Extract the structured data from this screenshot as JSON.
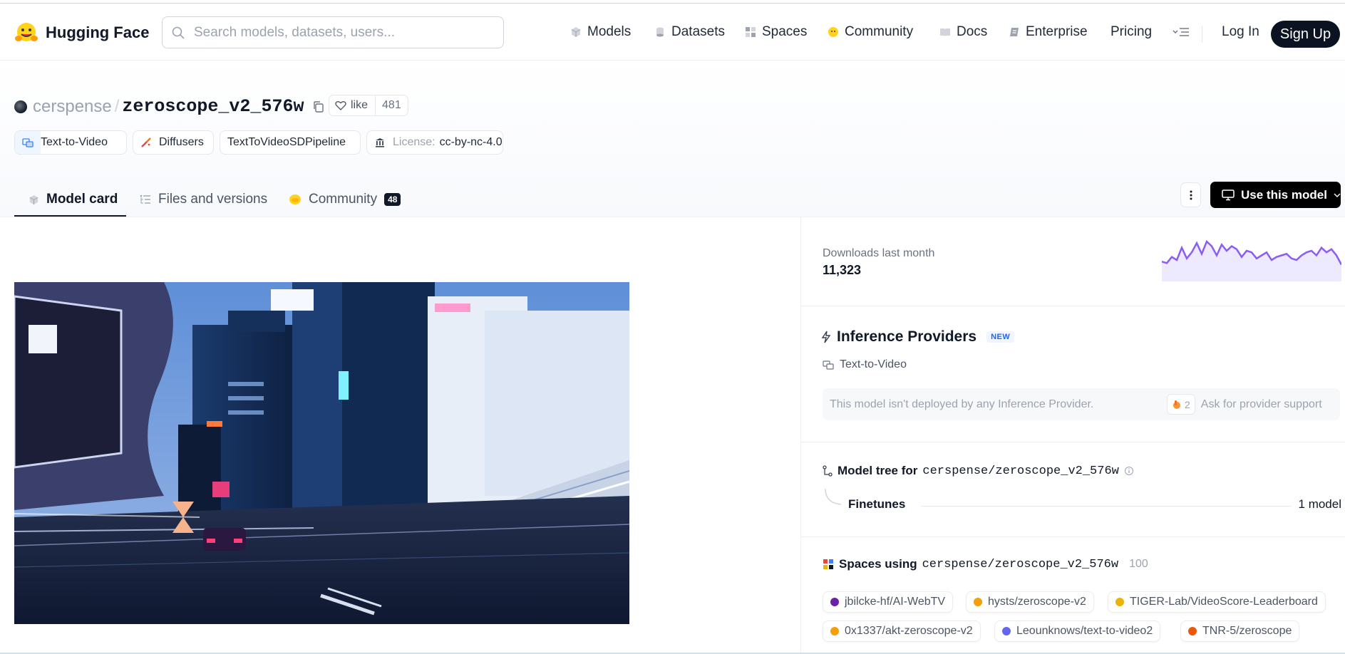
{
  "header": {
    "brand": "Hugging Face",
    "search_placeholder": "Search models, datasets, users...",
    "nav": [
      {
        "label": "Models",
        "icon": "models-icon"
      },
      {
        "label": "Datasets",
        "icon": "datasets-icon"
      },
      {
        "label": "Spaces",
        "icon": "spaces-icon"
      },
      {
        "label": "Community",
        "icon": "community-icon"
      },
      {
        "label": "Docs",
        "icon": "docs-icon"
      },
      {
        "label": "Enterprise",
        "icon": "enterprise-icon"
      },
      {
        "label": "Pricing",
        "icon": ""
      }
    ],
    "login": "Log In",
    "signup": "Sign Up"
  },
  "repo": {
    "owner": "cerspense",
    "separator": "/",
    "name": "zeroscope_v2_576w",
    "like_label": "like",
    "like_count": "481",
    "tags": [
      {
        "label": "Text-to-Video",
        "icon": "text-to-video-icon"
      },
      {
        "label": "Diffusers",
        "icon": "diffusers-icon"
      },
      {
        "label": "TextToVideoSDPipeline",
        "icon": ""
      },
      {
        "prefix": "License:",
        "label": "cc-by-nc-4.0",
        "icon": "license-icon"
      }
    ]
  },
  "tabs": [
    {
      "label": "Model card",
      "active": true
    },
    {
      "label": "Files and versions",
      "active": false
    },
    {
      "label": "Community",
      "badge": "48",
      "active": false
    }
  ],
  "use_model_label": "Use this model",
  "downloads": {
    "label": "Downloads last month",
    "value": "11,323",
    "sparkline": [
      22,
      20,
      28,
      24,
      40,
      26,
      34,
      46,
      32,
      48,
      42,
      30,
      44,
      36,
      42,
      38,
      28,
      36,
      34,
      26,
      30,
      34,
      24,
      28,
      30,
      32,
      26,
      24,
      30,
      34,
      36,
      30,
      40,
      34,
      38,
      30,
      18
    ]
  },
  "inference": {
    "title": "Inference Providers",
    "badge": "NEW",
    "task": "Text-to-Video",
    "message": "This model isn't deployed by any Inference Provider.",
    "provider_count": "2",
    "ask_label": "Ask for provider support"
  },
  "model_tree": {
    "prefix": "Model tree for",
    "repo": "cerspense/zeroscope_v2_576w",
    "finetunes_label": "Finetunes",
    "finetunes_count": "1 model"
  },
  "spaces": {
    "prefix": "Spaces using",
    "repo": "cerspense/zeroscope_v2_576w",
    "count": "100",
    "items": [
      {
        "label": "jbilcke-hf/AI-WebTV",
        "color": "#6b21a8"
      },
      {
        "label": "hysts/zeroscope-v2",
        "color": "#f59e0b"
      },
      {
        "label": "TIGER-Lab/VideoScore-Leaderboard",
        "color": "#eab308"
      },
      {
        "label": "0x1337/akt-zeroscope-v2",
        "color": "#f59e0b"
      },
      {
        "label": "Leounknows/text-to-video2",
        "color": "#6366f1"
      },
      {
        "label": "TNR-5/zeroscope",
        "color": "#ea580c"
      }
    ]
  },
  "colors": {
    "accent": "#8b5cf6",
    "dark": "#0b1221"
  }
}
